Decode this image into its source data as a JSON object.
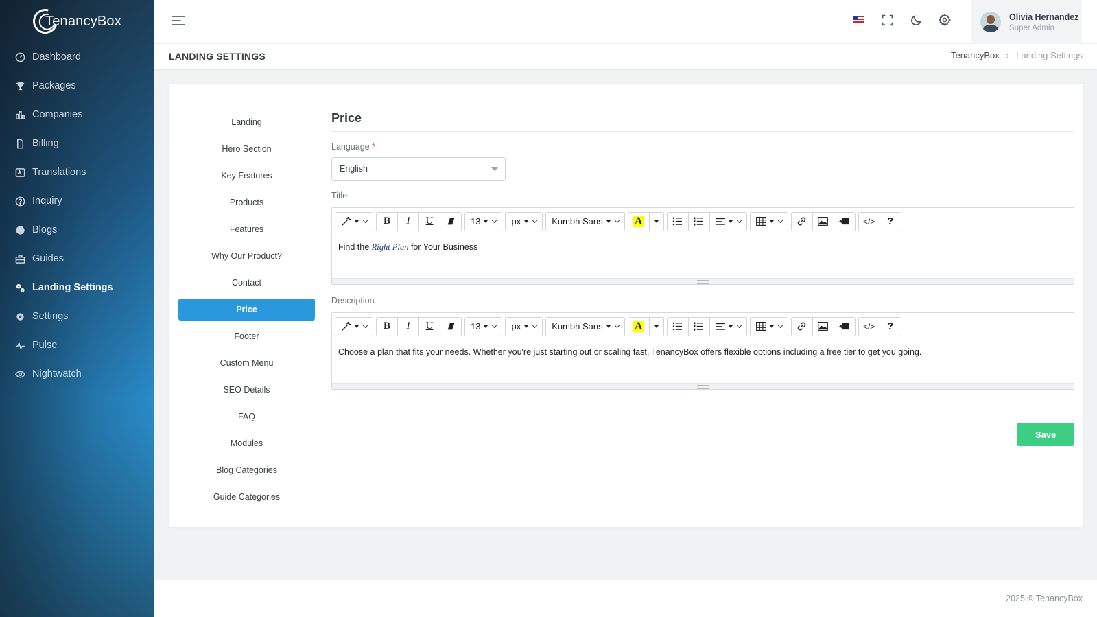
{
  "brand": {
    "name": "TenancyBox"
  },
  "sidebar": {
    "items": [
      {
        "label": "Dashboard",
        "icon": "gauge-icon"
      },
      {
        "label": "Packages",
        "icon": "trophy-icon"
      },
      {
        "label": "Companies",
        "icon": "chart-bars-icon"
      },
      {
        "label": "Billing",
        "icon": "document-icon"
      },
      {
        "label": "Translations",
        "icon": "translate-icon"
      },
      {
        "label": "Inquiry",
        "icon": "question-circle-icon"
      },
      {
        "label": "Blogs",
        "icon": "blog-icon"
      },
      {
        "label": "Guides",
        "icon": "briefcase-icon"
      },
      {
        "label": "Landing Settings",
        "icon": "cogs-icon",
        "active": true
      },
      {
        "label": "Settings",
        "icon": "gear-icon"
      },
      {
        "label": "Pulse",
        "icon": "pulse-icon"
      },
      {
        "label": "Nightwatch",
        "icon": "eye-icon"
      }
    ]
  },
  "topbar": {
    "user": {
      "name": "Olivia Hernandez",
      "role": "Super Admin"
    }
  },
  "page": {
    "title": "LANDING SETTINGS",
    "breadcrumb": [
      "TenancyBox",
      "Landing Settings"
    ]
  },
  "tabs": [
    "Landing",
    "Hero Section",
    "Key Features",
    "Products",
    "Features",
    "Why Our Product?",
    "Contact",
    "Price",
    "Footer",
    "Custom Menu",
    "SEO Details",
    "FAQ",
    "Modules",
    "Blog Categories",
    "Guide Categories"
  ],
  "active_tab": "Price",
  "form": {
    "section_title": "Price",
    "language_label": "Language",
    "required_mark": "*",
    "language_value": "English",
    "title_label": "Title",
    "title_parts": [
      "Find the ",
      "Right Plan",
      " for Your Business"
    ],
    "description_label": "Description",
    "description_text": "Choose a plan that fits your needs. Whether you're just starting out or scaling fast, TenancyBox offers flexible options including a free tier to get you going.",
    "save_label": "Save"
  },
  "toolbar": {
    "font_size": "13",
    "font_unit": "px",
    "font_family": "Kumbh Sans",
    "bold": "B",
    "italic": "I",
    "underline": "U",
    "highlight": "A",
    "help": "?",
    "code": "</>"
  },
  "footer": {
    "text": "2025 © TenancyBox"
  },
  "colors": {
    "accent": "#2a98dc",
    "save": "#3ccf84",
    "highlight": "#ffff00"
  }
}
